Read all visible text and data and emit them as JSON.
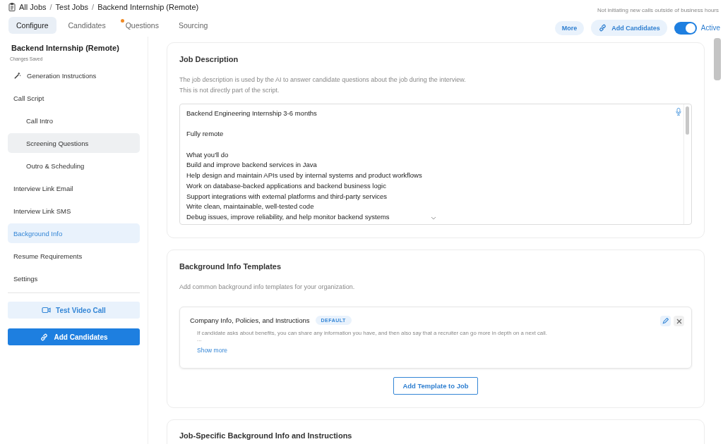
{
  "breadcrumb": [
    {
      "kind": "link",
      "text": "All Jobs"
    },
    {
      "kind": "separator",
      "text": "/"
    },
    {
      "kind": "link",
      "text": "Test Jobs"
    },
    {
      "kind": "separator",
      "text": "/"
    },
    {
      "kind": "link",
      "text": "Backend Internship (Remote)"
    }
  ],
  "notice": "Not initiating new calls outside of business hours",
  "tabs": [
    {
      "label": "Configure",
      "selected": true,
      "dot": false
    },
    {
      "label": "Candidates",
      "selected": false,
      "dot": false
    },
    {
      "label": "Questions",
      "selected": false,
      "dot": true
    },
    {
      "label": "Sourcing",
      "selected": false,
      "dot": false
    }
  ],
  "header_actions": {
    "more": "More",
    "add_candidates": "Add Candidates",
    "toggle": {
      "label": "Active",
      "on": true
    }
  },
  "sidebar": {
    "title": "Backend Internship (Remote)",
    "status": "Changes Saved",
    "items": [
      {
        "label": "Generation Instructions",
        "icon": true,
        "selected": false,
        "hovered": false
      },
      {
        "label": "Call Script",
        "icon": false,
        "selected": false,
        "hovered": false,
        "children": [
          {
            "label": "Call Intro",
            "selected": false,
            "hovered": false
          },
          {
            "label": "Screening Questions",
            "selected": false,
            "hovered": true
          },
          {
            "label": "Outro & Scheduling",
            "selected": false,
            "hovered": false
          }
        ]
      },
      {
        "label": "Interview Link Email",
        "icon": false,
        "selected": false,
        "hovered": false
      },
      {
        "label": "Interview Link SMS",
        "icon": false,
        "selected": false,
        "hovered": false
      },
      {
        "label": "Background Info",
        "icon": false,
        "selected": true,
        "hovered": false
      },
      {
        "label": "Resume Requirements",
        "icon": false,
        "selected": false,
        "hovered": false
      },
      {
        "label": "Settings",
        "icon": false,
        "selected": false,
        "hovered": false
      }
    ],
    "test_call": "Test Video Call",
    "add_candidates": "Add Candidates"
  },
  "job_description": {
    "title": "Job Description",
    "help": [
      "The job description is used by the AI to answer candidate questions about the job during the interview.",
      "This is not directly part of the script."
    ],
    "paragraphs": [
      [
        "Backend Engineering Internship 3-6 months"
      ],
      [
        "Fully remote"
      ],
      [
        "What you'll do",
        "Build and improve backend services in Java",
        "Help design and maintain APIs used by internal systems and product workflows",
        "Work on database-backed applications and backend business logic",
        "Support integrations with external platforms and third-party services",
        "Write clean, maintainable, well-tested code",
        "Debug issues, improve reliability, and help monitor backend systems"
      ]
    ]
  },
  "templates": {
    "title": "Background Info Templates",
    "help": "Add common background info templates for your organization.",
    "items": [
      {
        "name": "Company Info, Policies, and Instructions",
        "badge": "DEFAULT",
        "text": "If candidate asks about benefits, you can share any information you have, and then also say that a recruiter can go more in depth on a next call.",
        "ellipsis": "...",
        "show_more": "Show more"
      }
    ],
    "add_button": "Add Template to Job"
  },
  "job_specific": {
    "title": "Job-Specific Background Info and Instructions"
  }
}
